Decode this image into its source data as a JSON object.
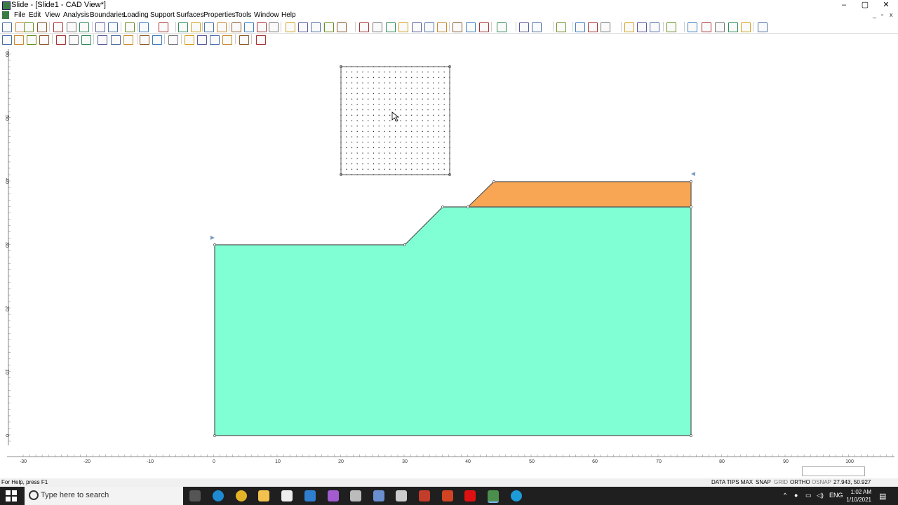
{
  "window": {
    "title": "Slide - [Slide1 - CAD View*]",
    "min": "–",
    "max": "▢",
    "close": "✕"
  },
  "menu": [
    "File",
    "Edit",
    "View",
    "Analysis",
    "Boundaries",
    "Loading",
    "Support",
    "Surfaces",
    "Properties",
    "Tools",
    "Window",
    "Help"
  ],
  "axes": {
    "x_ticks": [
      "-30",
      "-20",
      "-10",
      "0",
      "10",
      "20",
      "30",
      "40",
      "50",
      "60",
      "70",
      "80",
      "90",
      "100"
    ],
    "y_ticks": [
      "60",
      "50",
      "40",
      "30",
      "20",
      "10",
      "0"
    ]
  },
  "model": {
    "grid_cols": 21,
    "grid_rows": 21,
    "colors": {
      "material_1": "#80ffd4",
      "material_2": "#f8a654",
      "outline": "#555555"
    }
  },
  "status": {
    "help": "For Help, press F1",
    "data_tips": "DATA TIPS MAX",
    "snap": "SNAP",
    "grid": "GRID",
    "ortho": "ORTHO",
    "osnap": "OSNAP",
    "coords": "27.943, 50.927"
  },
  "taskbar": {
    "search_placeholder": "Type here to search",
    "lang": "ENG",
    "time": "1:02 AM",
    "date": "1/10/2021"
  }
}
